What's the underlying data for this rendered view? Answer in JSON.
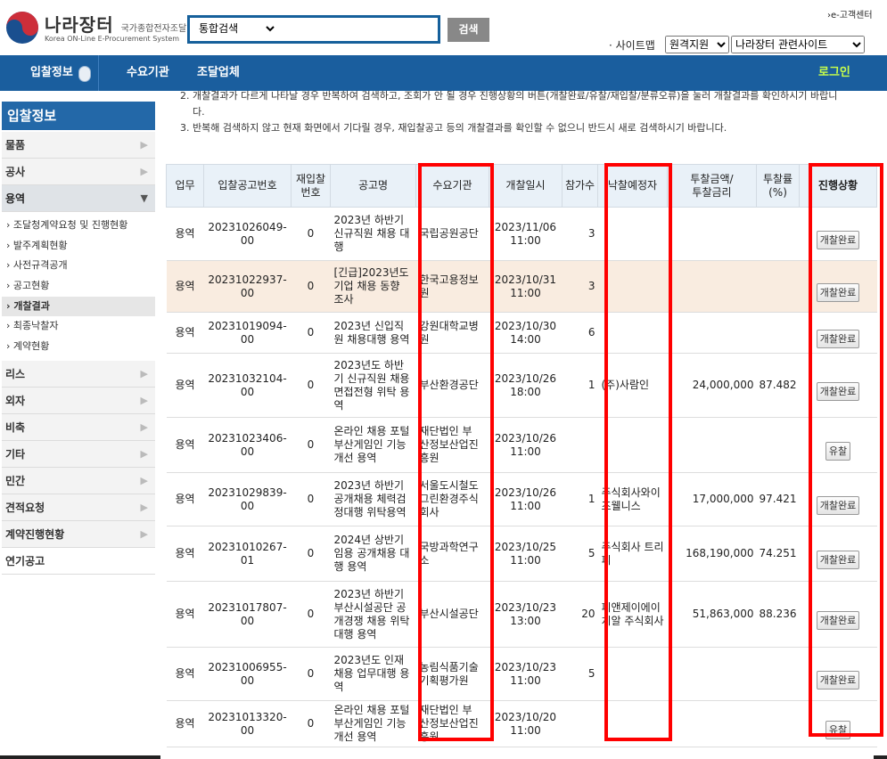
{
  "header": {
    "logo_title": "나라장터",
    "logo_sub": "국가종합전자조달",
    "logo_en": "Korea ON-Line E-Procurement System",
    "search_scope": "통합검색",
    "search_value": "",
    "search_button": "검색",
    "customer_center": "›e-고객센터",
    "sitemap": "· 사이트맵",
    "remote_support": "원격지원",
    "related_sites": "나라장터 관련사이트"
  },
  "nav": {
    "items": [
      "입찰정보",
      "수요기관",
      "조달업체"
    ],
    "login": "로그인"
  },
  "sidebar": {
    "title": "입찰정보",
    "top_items": [
      "물품",
      "공사",
      "용역"
    ],
    "sub_items": [
      "조달청계약요청 및 진행현황",
      "발주계획현황",
      "사전규격공개",
      "공고현황",
      "개찰결과",
      "최종낙찰자",
      "계약현황"
    ],
    "bottom_items": [
      "리스",
      "외자",
      "비축",
      "기타",
      "민간",
      "견적요청",
      "계약진행현황",
      "연기공고"
    ]
  },
  "notice": {
    "line1": "2. 개찰결과가 다르게 나타날 경우 반복하여 검색하고, 조회가 안 될 경우 진행상황의 버튼(개찰완료/유찰/재입찰/분류오류)을 눌러 개찰결과를 확인하시기 바랍니",
    "line1b": "다.",
    "line2": "3. 반복해 검색하지 않고 현재 화면에서 기다릴 경우, 재입찰공고 등의 개찰결과를 확인할 수 없으니 반드시 새로 검색하시기 바랍니다."
  },
  "table": {
    "headers": [
      "업무",
      "입찰공고번호",
      "재입찰\n번호",
      "공고명",
      "수요기관",
      "개찰일시",
      "참가수",
      "낙찰예정자",
      "투찰금액/\n투찰금리",
      "투찰률\n(%)",
      "진행상황"
    ],
    "rows": [
      {
        "biz": "용역",
        "no": "20231026049-00",
        "rebid": "0",
        "title": "2023년 하반기 신규직원 채용 대행",
        "agency": "국립공원공단",
        "date": "2023/11/06",
        "time": "11:00",
        "count": "3",
        "winner": "",
        "amount": "",
        "rate": "",
        "status": "개찰완료"
      },
      {
        "biz": "용역",
        "no": "20231022937-00",
        "rebid": "0",
        "title": "[긴급]2023년도 기업 채용 동향 조사",
        "agency": "한국고용정보원",
        "date": "2023/10/31",
        "time": "11:00",
        "count": "3",
        "winner": "",
        "amount": "",
        "rate": "",
        "status": "개찰완료"
      },
      {
        "biz": "용역",
        "no": "20231019094-00",
        "rebid": "0",
        "title": "2023년 신입직원 채용대행 용역",
        "agency": "강원대학교병원",
        "date": "2023/10/30",
        "time": "14:00",
        "count": "6",
        "winner": "",
        "amount": "",
        "rate": "",
        "status": "개찰완료"
      },
      {
        "biz": "용역",
        "no": "20231032104-00",
        "rebid": "0",
        "title": "2023년도 하반기 신규직원 채용 면접전형 위탁 용역",
        "agency": "부산환경공단",
        "date": "2023/10/26",
        "time": "18:00",
        "count": "1",
        "winner": "(주)사람인",
        "amount": "24,000,000",
        "rate": "87.482",
        "status": "개찰완료"
      },
      {
        "biz": "용역",
        "no": "20231023406-00",
        "rebid": "0",
        "title": "온라인 채용 포털 부산게임인 기능 개선 용역",
        "agency": "재단법인 부산정보산업진흥원",
        "date": "2023/10/26",
        "time": "11:00",
        "count": "",
        "winner": "",
        "amount": "",
        "rate": "",
        "status": "유찰"
      },
      {
        "biz": "용역",
        "no": "20231029839-00",
        "rebid": "0",
        "title": "2023년 하반기 공개채용 체력검정대행 위탁용역",
        "agency": "서울도시철도그린환경주식회사",
        "date": "2023/10/26",
        "time": "11:00",
        "count": "1",
        "winner": "주식회사와이즈웰니스",
        "amount": "17,000,000",
        "rate": "97.421",
        "status": "개찰완료"
      },
      {
        "biz": "용역",
        "no": "20231010267-01",
        "rebid": "0",
        "title": "2024년 상반기 임용 공개채용 대행 용역",
        "agency": "국방과학연구소",
        "date": "2023/10/25",
        "time": "11:00",
        "count": "5",
        "winner": "주식회사 트리피",
        "amount": "168,190,000",
        "rate": "74.251",
        "status": "개찰완료"
      },
      {
        "biz": "용역",
        "no": "20231017807-00",
        "rebid": "0",
        "title": "2023년 하반기 부산시설공단 공개경쟁 채용 위탁대행 용역",
        "agency": "부산시설공단",
        "date": "2023/10/23",
        "time": "13:00",
        "count": "20",
        "winner": "피앤제이에이치알 주식회사",
        "amount": "51,863,000",
        "rate": "88.236",
        "status": "개찰완료"
      },
      {
        "biz": "용역",
        "no": "20231006955-00",
        "rebid": "0",
        "title": "2023년도 인재채용 업무대행 용역",
        "agency": "농림식품기술기획평가원",
        "date": "2023/10/23",
        "time": "11:00",
        "count": "5",
        "winner": "",
        "amount": "",
        "rate": "",
        "status": "개찰완료"
      },
      {
        "biz": "용역",
        "no": "20231013320-00",
        "rebid": "0",
        "title": "온라인 채용 포털 부산게임인 기능 개선 용역",
        "agency": "재단법인 부산정보산업진흥원",
        "date": "2023/10/20",
        "time": "11:00",
        "count": "",
        "winner": "",
        "amount": "",
        "rate": "",
        "status": "유찰"
      }
    ]
  },
  "colors": {
    "nav": "#1a5e9e",
    "highlight_box": "#ff0000",
    "login": "#c8ff4a"
  }
}
